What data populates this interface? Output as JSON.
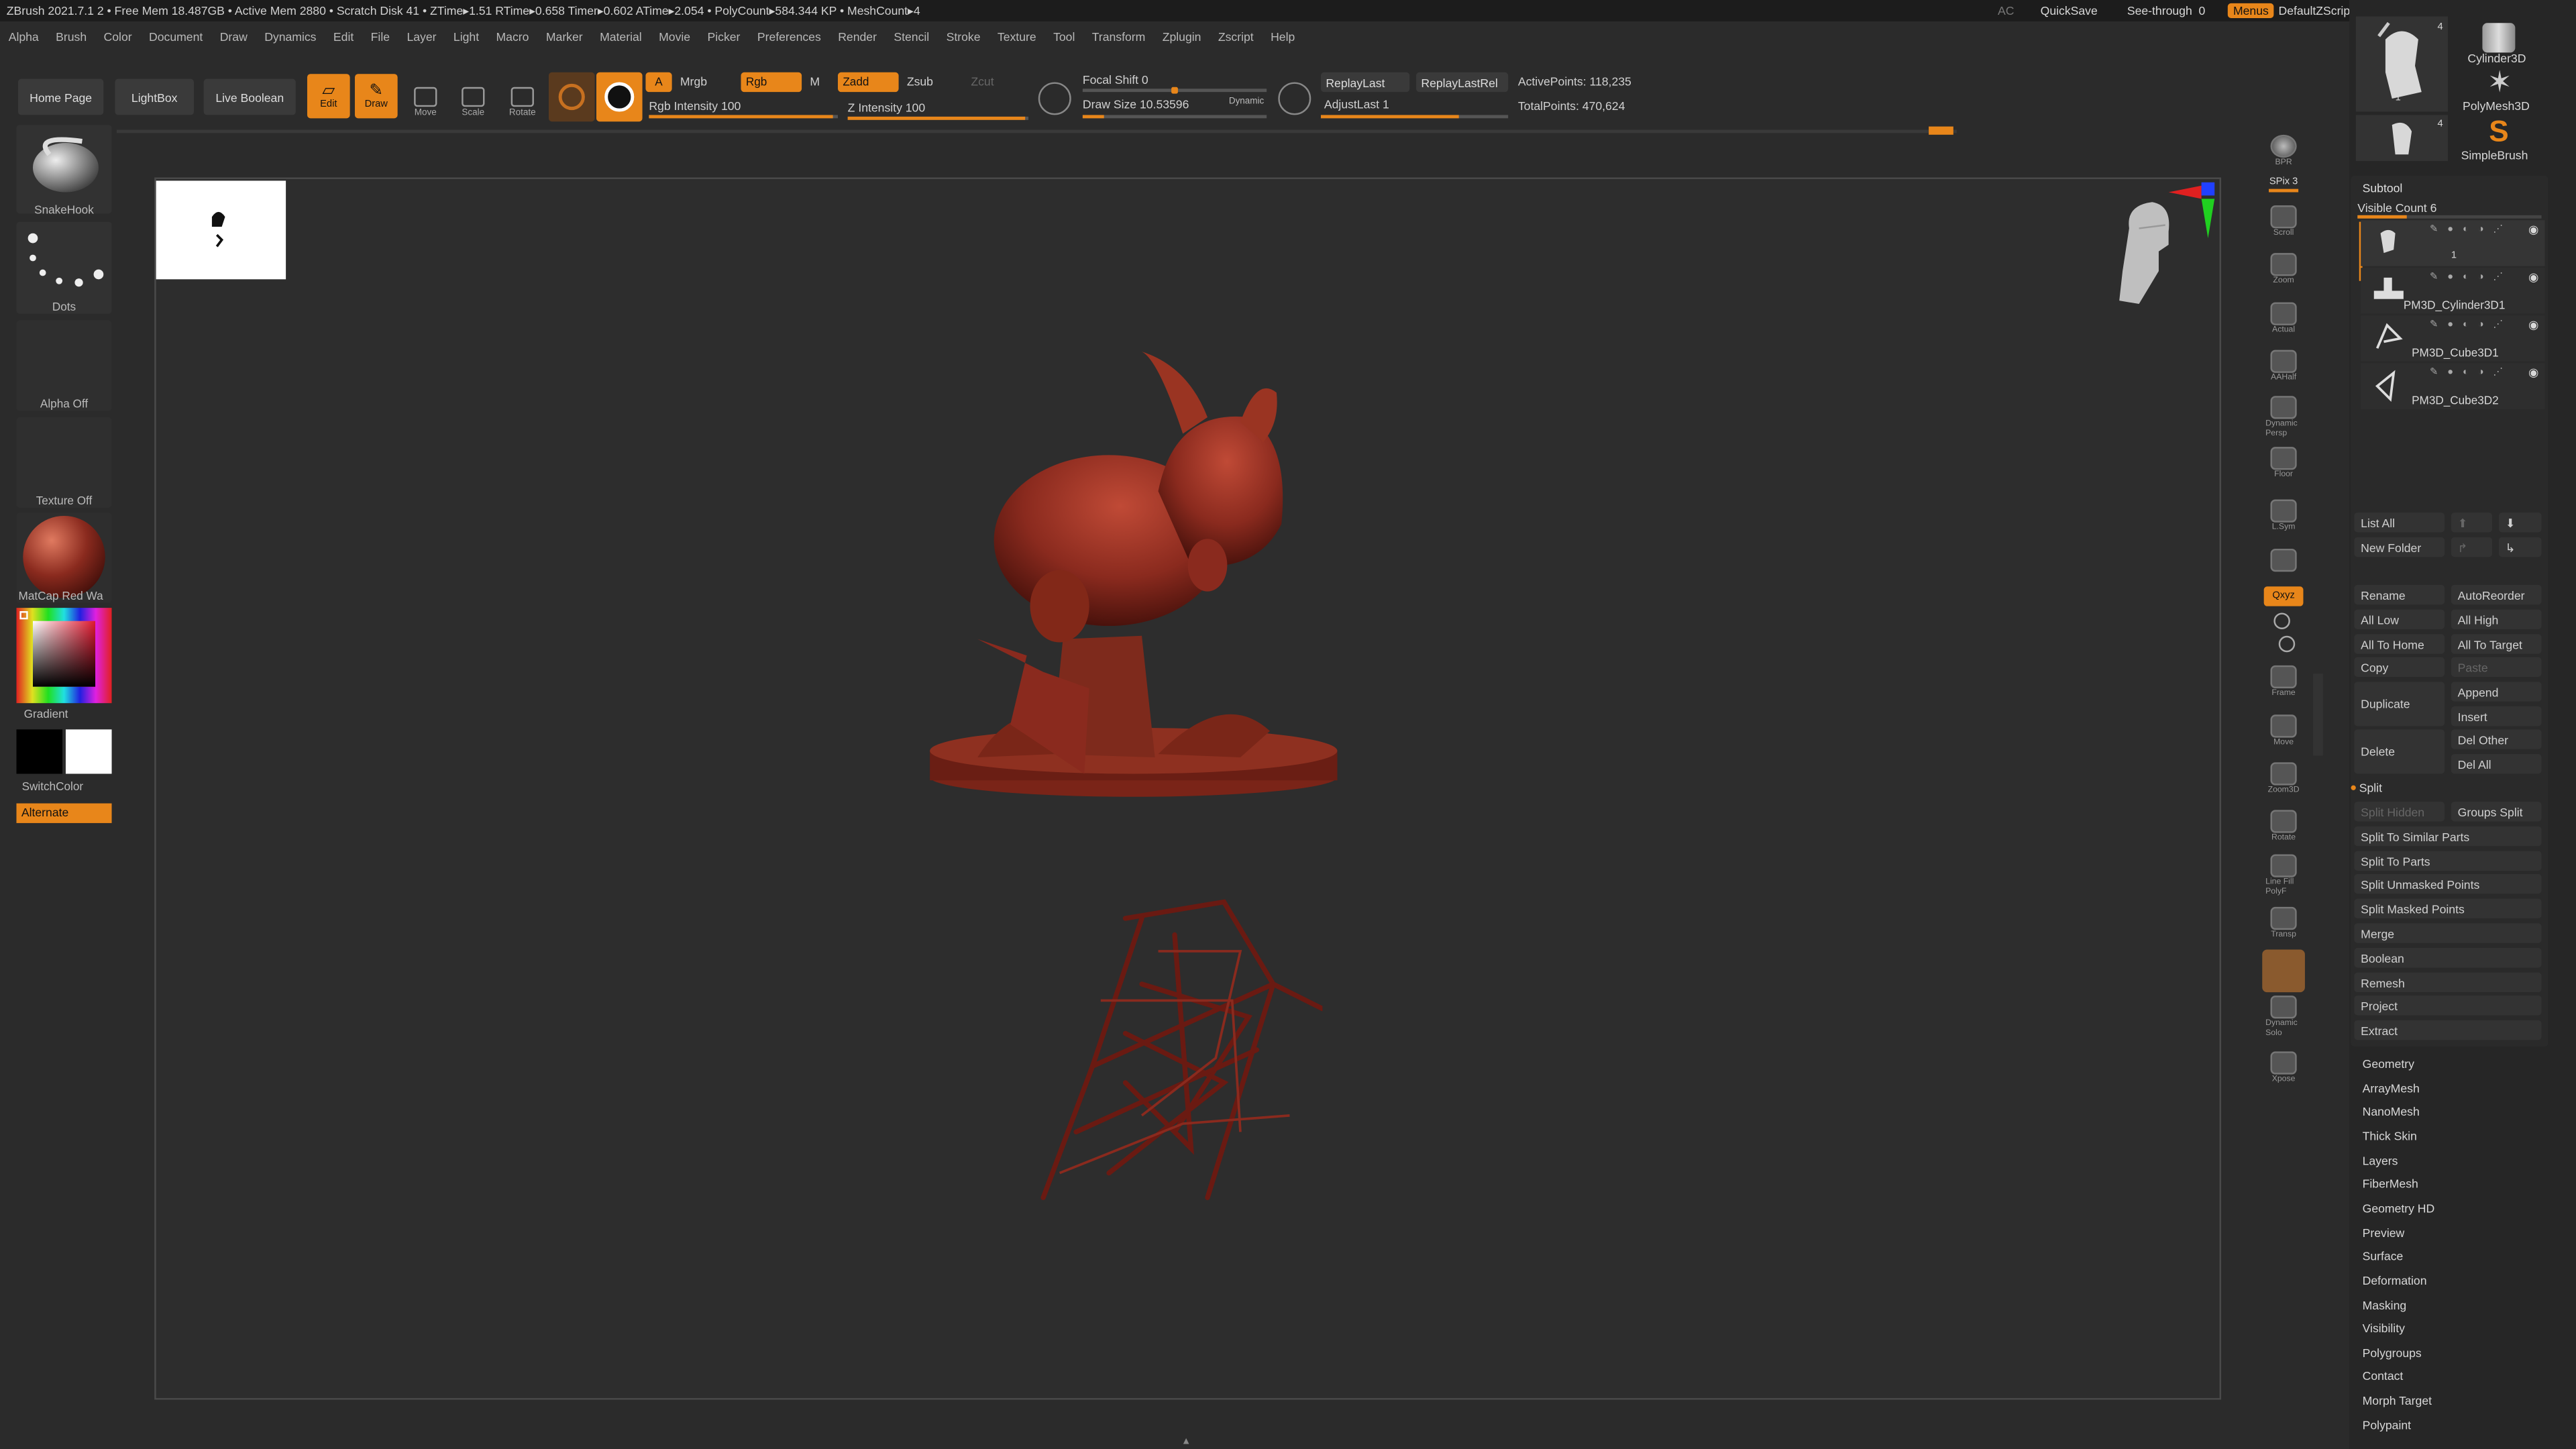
{
  "titlebar": {
    "title": "ZBrush 2021.7.1  2 • Free Mem 18.487GB • Active Mem 2880 • Scratch Disk 41 •  ZTime▸1.51 RTime▸0.658 Timer▸0.602 ATime▸2.054 • PolyCount▸584.344 KP  • MeshCount▸4",
    "ac": "AC",
    "quicksave": "QuickSave",
    "seethrough": "See-through",
    "seethrough_value": "0",
    "menus": "Menus",
    "script": "DefaultZScript"
  },
  "menubar": [
    "Alpha",
    "Brush",
    "Color",
    "Document",
    "Draw",
    "Dynamics",
    "Edit",
    "File",
    "Layer",
    "Light",
    "Macro",
    "Marker",
    "Material",
    "Movie",
    "Picker",
    "Preferences",
    "Render",
    "Stencil",
    "Stroke",
    "Texture",
    "Tool",
    "Transform",
    "Zplugin",
    "Zscript",
    "Help"
  ],
  "toolbar": {
    "home": "Home Page",
    "lightbox": "LightBox",
    "liveboolean": "Live Boolean",
    "edit": "Edit",
    "draw": "Draw",
    "move": "Move",
    "scale": "Scale",
    "rotate": "Rotate",
    "a": "A",
    "mrgb": "Mrgb",
    "rgb": "Rgb",
    "m": "M",
    "zadd": "Zadd",
    "zsub": "Zsub",
    "zcut": "Zcut",
    "rgb_intensity": "Rgb Intensity 100",
    "z_intensity": "Z Intensity 100",
    "focal_shift": "Focal Shift 0",
    "draw_size": "Draw Size 10.53596",
    "dynamic": "Dynamic",
    "replaylast": "ReplayLast",
    "replaylastrel": "ReplayLastRel",
    "adjustlast": "AdjustLast 1",
    "activepoints": "ActivePoints: 118,235",
    "totalpoints": "TotalPoints: 470,624"
  },
  "leftshelf": {
    "brush": "SnakeHook",
    "stroke": "Dots",
    "alpha": "Alpha Off",
    "texture": "Texture Off",
    "material": "MatCap Red Wa",
    "gradient": "Gradient",
    "switchcolor": "SwitchColor",
    "alternate": "Alternate"
  },
  "rightshelf": [
    "BPR",
    "SPix 3",
    "Scroll",
    "Zoom",
    "Actual",
    "AAHalf",
    "Dynamic Persp",
    "Floor",
    "L.Sym",
    "Lock",
    "Qxyz",
    "Frame",
    "Move",
    "Zoom3D",
    "Rotate",
    "Line Fill PolyF",
    "Transp",
    "Ghost",
    "Dynamic Solo",
    "Xpose"
  ],
  "toolpanel": {
    "tools": [
      {
        "name": "",
        "count": "4"
      },
      {
        "name": "Cylinder3D",
        "count": ""
      },
      {
        "name": "",
        "count": "1"
      },
      {
        "name": "PolyMesh3D",
        "count": ""
      },
      {
        "name": "",
        "count": "4"
      },
      {
        "name": "SimpleBrush",
        "count": ""
      }
    ],
    "subtool_title": "Subtool",
    "visible_count": "Visible Count 6",
    "subtools": [
      "1",
      "PM3D_Cylinder3D1",
      "PM3D_Cube3D1",
      "PM3D_Cube3D2"
    ],
    "list_all": "List All",
    "new_folder": "New Folder",
    "rename": "Rename",
    "autoreorder": "AutoReorder",
    "all_low": "All Low",
    "all_high": "All High",
    "all_to_home": "All To Home",
    "all_to_target": "All To Target",
    "copy": "Copy",
    "paste": "Paste",
    "duplicate": "Duplicate",
    "append": "Append",
    "insert": "Insert",
    "delete": "Delete",
    "del_other": "Del Other",
    "del_all": "Del All",
    "split": "Split",
    "split_hidden": "Split Hidden",
    "groups_split": "Groups Split",
    "split_similar": "Split To Similar Parts",
    "split_parts": "Split To Parts",
    "split_unmasked": "Split Unmasked Points",
    "split_masked": "Split Masked Points",
    "merge": "Merge",
    "boolean": "Boolean",
    "remesh": "Remesh",
    "project": "Project",
    "extract": "Extract",
    "sections": [
      "Geometry",
      "ArrayMesh",
      "NanoMesh",
      "Thick Skin",
      "Layers",
      "FiberMesh",
      "Geometry HD",
      "Preview",
      "Surface",
      "Deformation",
      "Masking",
      "Visibility",
      "Polygroups",
      "Contact",
      "Morph Target",
      "Polypaint"
    ]
  },
  "colors": {
    "accent": "#e8861a",
    "material": "#8a2a1e",
    "bg": "#2b2b2b"
  }
}
